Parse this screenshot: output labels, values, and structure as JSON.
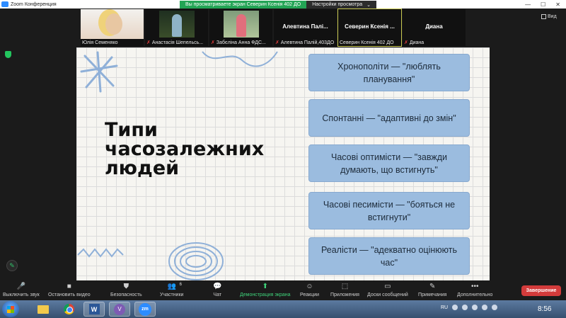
{
  "window": {
    "title": "Zoom Конференция"
  },
  "share_banner": {
    "message": "Вы просматриваете экран Северин Ксенія 402 ДО",
    "options_label": "Настройки просмотра",
    "options_caret": "⌄"
  },
  "participants": [
    {
      "name": "Юлія Семеняко",
      "muted": false,
      "video": true
    },
    {
      "name": "Анастасія Шепельсь...",
      "muted": true,
      "video": true
    },
    {
      "name": "Забєліна  Анна ФДС...",
      "muted": true,
      "video": true
    },
    {
      "name": "Алевтина Палій,403ДО",
      "display": "Алевтина  Палі...",
      "muted": true,
      "video": false
    },
    {
      "name": "Северин Ксенія 402 ДО",
      "display": "Северин  Ксенія ...",
      "muted": false,
      "video": false,
      "active": true
    },
    {
      "name": "Диана",
      "display": "Диана",
      "muted": true,
      "video": false
    }
  ],
  "view_button": {
    "label": "Вид"
  },
  "slide": {
    "title_lines": [
      "Типи",
      "часозалежних",
      "людей"
    ],
    "cards": [
      "Хронополіти — \"люблять планування\"",
      "Спонтанні — \"адаптивні до змін\"",
      "Часові оптимісти — \"завжди думають, що встигнуть\"",
      "Часові песимісти — \"бояться не встигнути\"",
      "Реалісти — \"адекватно оцінюють час\""
    ],
    "colors": {
      "card_bg": "#9bbcdf",
      "slide_bg": "#f6f5f1",
      "deco": "#8fb0d8"
    }
  },
  "toolbar": {
    "buttons": [
      {
        "id": "mute",
        "icon": "🎤",
        "label": "Выключить звук"
      },
      {
        "id": "video",
        "icon": "■",
        "label": "Остановить видео"
      },
      {
        "id": "security",
        "icon": "⛊",
        "label": "Безопасность"
      },
      {
        "id": "participants",
        "icon": "👥",
        "label": "Участники",
        "badge": "6"
      },
      {
        "id": "chat",
        "icon": "💬",
        "label": "Чат"
      },
      {
        "id": "share",
        "icon": "⬆",
        "label": "Демонстрация экрана"
      },
      {
        "id": "reactions",
        "icon": "☺",
        "label": "Реакции"
      },
      {
        "id": "apps",
        "icon": "⬚",
        "label": "Приложения"
      },
      {
        "id": "whiteboards",
        "icon": "▭",
        "label": "Доски сообщений"
      },
      {
        "id": "notes",
        "icon": "✎",
        "label": "Примечания"
      },
      {
        "id": "more",
        "icon": "•••",
        "label": "Дополнительно"
      }
    ],
    "end_label": "Завершение"
  },
  "taskbar": {
    "tray": {
      "lang": "RU"
    },
    "clock": "8:56",
    "apps": [
      {
        "id": "explorer",
        "icon": "folder-icon"
      },
      {
        "id": "chrome",
        "icon": "chrome-icon"
      },
      {
        "id": "word",
        "icon": "word-icon",
        "label": "W"
      },
      {
        "id": "viber",
        "icon": "viber-icon",
        "label": "V"
      },
      {
        "id": "zoom",
        "icon": "zoom-icon",
        "label": "zm"
      }
    ]
  }
}
